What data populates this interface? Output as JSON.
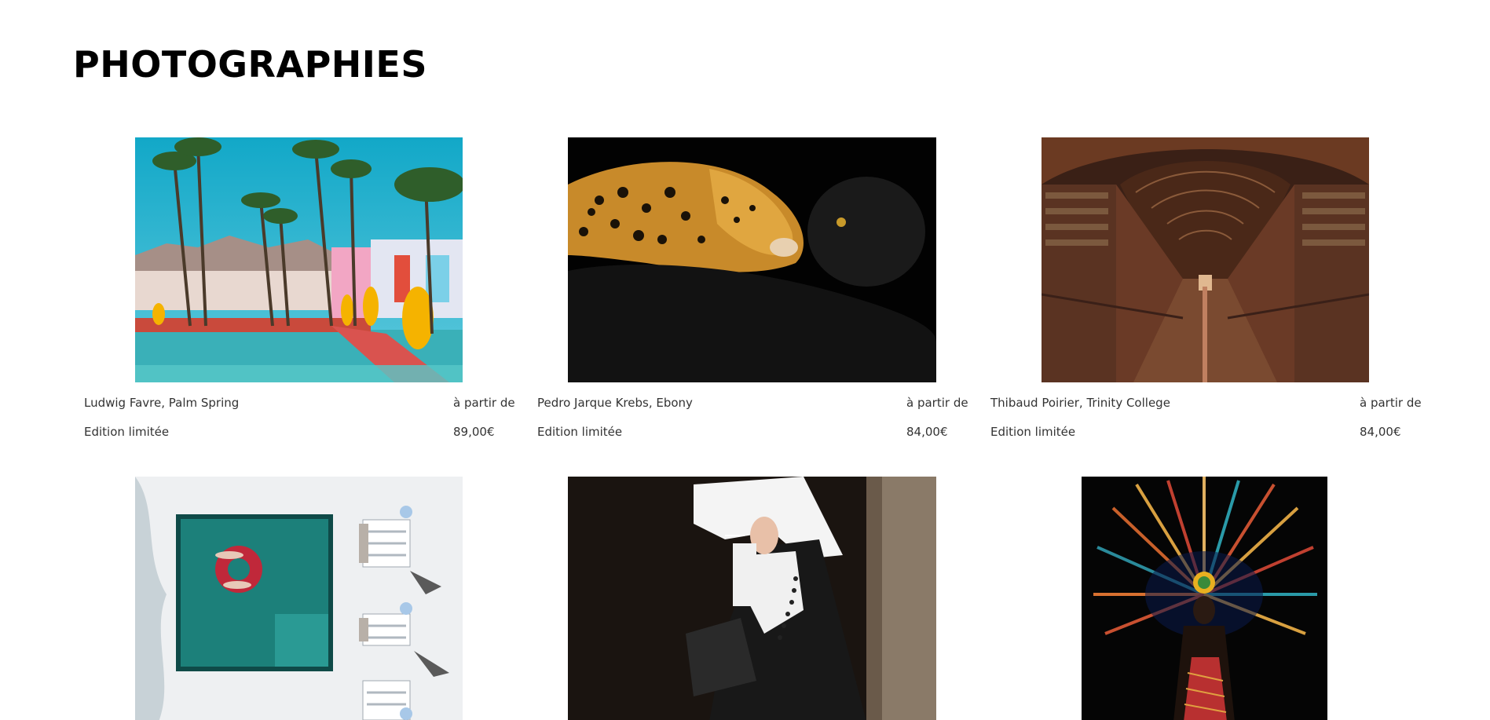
{
  "page": {
    "title": "PHOTOGRAPHIES"
  },
  "products": [
    {
      "artist_title": "Ludwig Favre, Palm Spring",
      "price_prefix": "à partir de",
      "edition": "Edition limitée",
      "price": "89,00€",
      "image": "palm-springs-pool-photo"
    },
    {
      "artist_title": "Pedro Jarque Krebs, Ebony",
      "price_prefix": "à partir de",
      "edition": "Edition limitée",
      "price": "84,00€",
      "image": "jaguar-panther-photo"
    },
    {
      "artist_title": "Thibaud Poirier, Trinity College",
      "price_prefix": "à partir de",
      "edition": "Edition limitée",
      "price": "84,00€",
      "image": "library-hall-photo"
    },
    {
      "image": "aerial-pool-photo"
    },
    {
      "image": "nun-smoking-photo"
    },
    {
      "image": "feather-headdress-photo"
    }
  ]
}
